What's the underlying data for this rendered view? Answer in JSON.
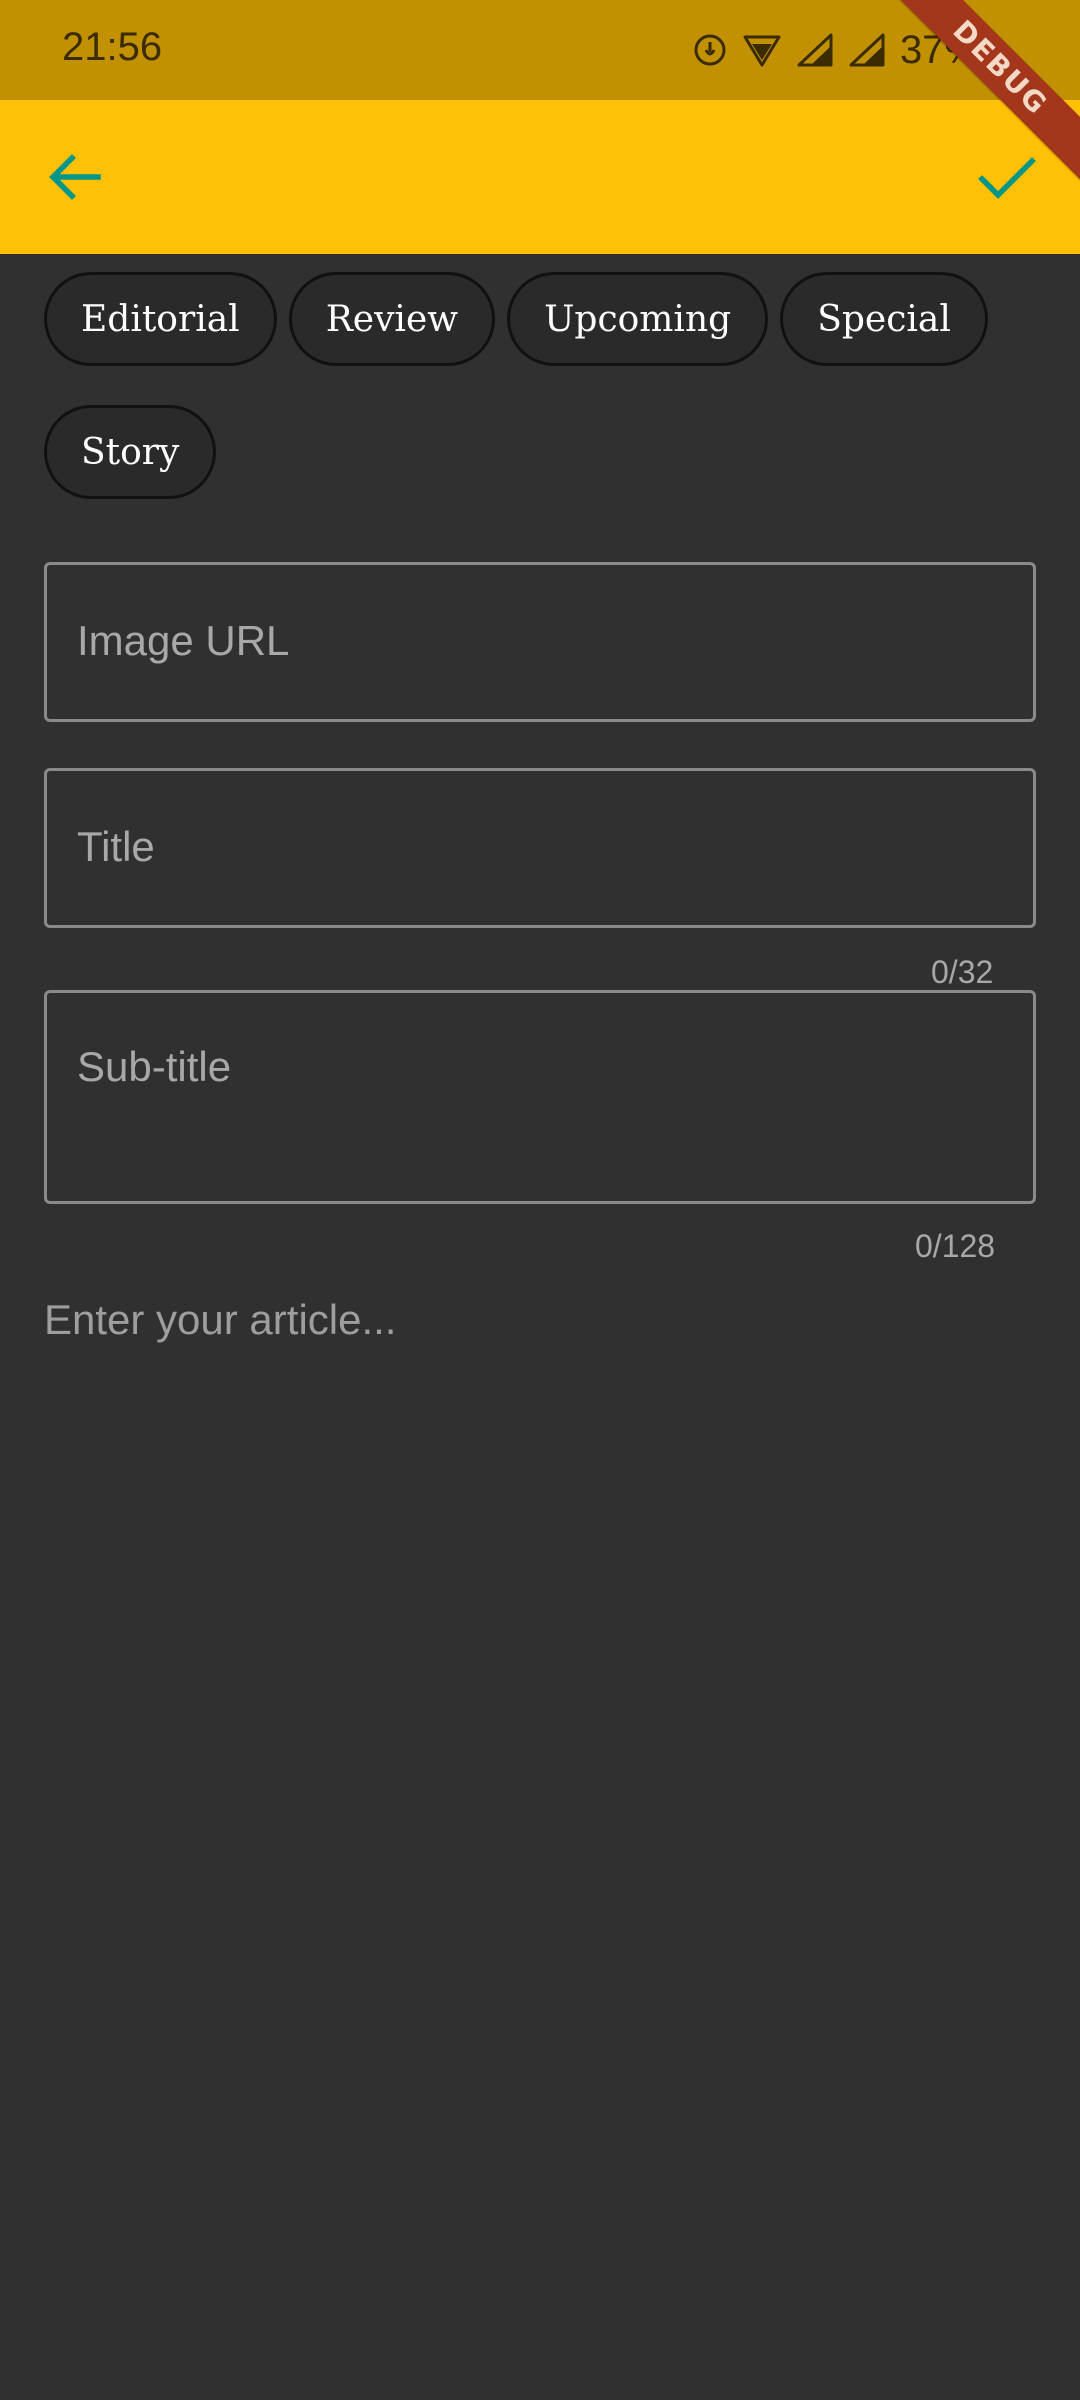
{
  "status_bar": {
    "time": "21:56",
    "battery": "37%",
    "icons": [
      "data-saver-icon",
      "wifi-icon",
      "signal-icon",
      "signal-icon-2"
    ]
  },
  "debug_banner": "DEBUG",
  "app_bar": {
    "back_icon": "arrow-left-icon",
    "confirm_icon": "check-icon",
    "background": "#ffc107",
    "icon_color": "#009688"
  },
  "categories": [
    "Editorial",
    "Review",
    "Upcoming",
    "Special",
    "Story"
  ],
  "form": {
    "image_url": {
      "placeholder": "Image URL",
      "value": ""
    },
    "title": {
      "placeholder": "Title",
      "value": "",
      "counter": "0/32"
    },
    "subtitle": {
      "placeholder": "Sub-title",
      "value": "",
      "counter": "0/128"
    },
    "article": {
      "placeholder": "Enter your article...",
      "value": ""
    }
  }
}
